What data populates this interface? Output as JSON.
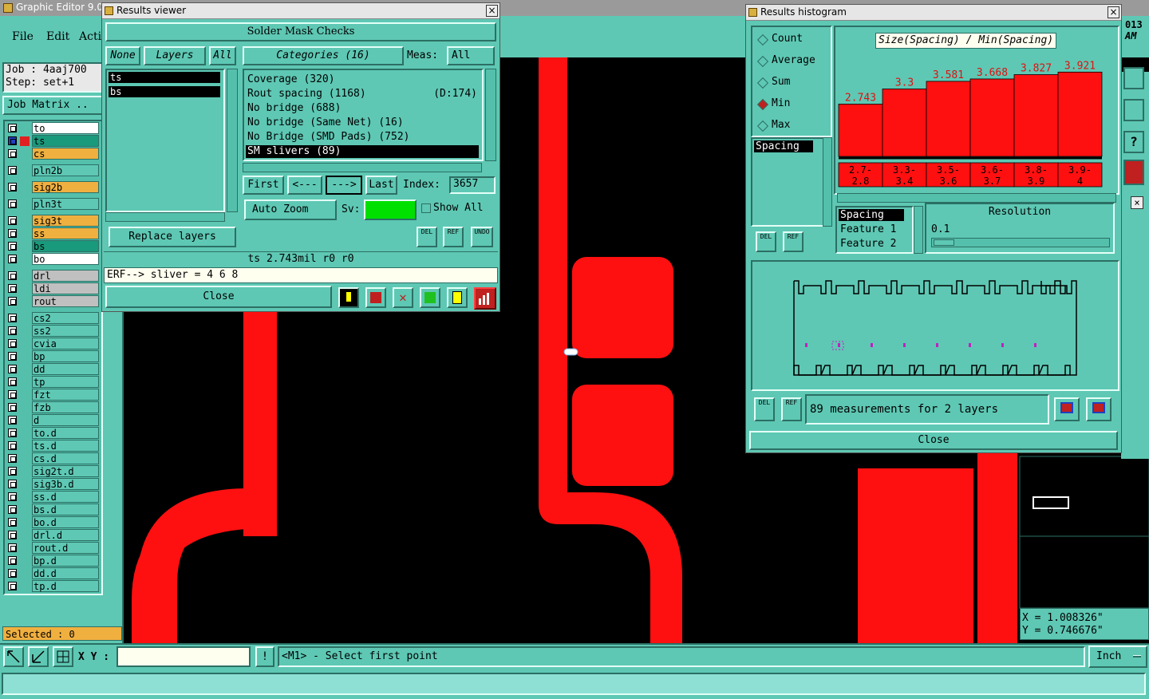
{
  "app": {
    "title": "Graphic Editor 9.02",
    "right_frag": "013",
    "right_frag2": "AM"
  },
  "menu": [
    "File",
    "Edit",
    "Acti"
  ],
  "job": {
    "job_label": "Job : 4aaj700",
    "step_label": "Step: set+1",
    "matrix_button": "Job Matrix .."
  },
  "layers": [
    {
      "name": "to",
      "color": "#ffffff"
    },
    {
      "name": "ts",
      "color": "#1a9a7c",
      "active": true
    },
    {
      "name": "cs",
      "color": "#f0b040"
    },
    {
      "name": "pln2b",
      "color": "#5ec8b4"
    },
    {
      "name": "sig2b",
      "color": "#f0b040"
    },
    {
      "name": "pln3t",
      "color": "#5ec8b4"
    },
    {
      "name": "sig3t",
      "color": "#f0b040"
    },
    {
      "name": "ss",
      "color": "#f0b040"
    },
    {
      "name": "bs",
      "color": "#1a9a7c"
    },
    {
      "name": "bo",
      "color": "#ffffff"
    },
    {
      "name": "drl",
      "color": "#c0c0c0"
    },
    {
      "name": "ldi",
      "color": "#c0c0c0"
    },
    {
      "name": "rout",
      "color": "#c0c0c0"
    },
    {
      "name": "cs2",
      "color": "#5ec8b4"
    },
    {
      "name": "ss2",
      "color": "#5ec8b4"
    },
    {
      "name": "cvia",
      "color": "#5ec8b4"
    },
    {
      "name": "bp",
      "color": "#5ec8b4"
    },
    {
      "name": "dd",
      "color": "#5ec8b4"
    },
    {
      "name": "tp",
      "color": "#5ec8b4"
    },
    {
      "name": "fzt",
      "color": "#5ec8b4"
    },
    {
      "name": "fzb",
      "color": "#5ec8b4"
    },
    {
      "name": "d",
      "color": "#5ec8b4"
    },
    {
      "name": "to.d",
      "color": "#5ec8b4"
    },
    {
      "name": "ts.d",
      "color": "#5ec8b4"
    },
    {
      "name": "cs.d",
      "color": "#5ec8b4"
    },
    {
      "name": "sig2t.d",
      "color": "#5ec8b4"
    },
    {
      "name": "sig3b.d",
      "color": "#5ec8b4"
    },
    {
      "name": "ss.d",
      "color": "#5ec8b4"
    },
    {
      "name": "bs.d",
      "color": "#5ec8b4"
    },
    {
      "name": "bo.d",
      "color": "#5ec8b4"
    },
    {
      "name": "drl.d",
      "color": "#5ec8b4"
    },
    {
      "name": "rout.d",
      "color": "#5ec8b4"
    },
    {
      "name": "bp.d",
      "color": "#5ec8b4"
    },
    {
      "name": "dd.d",
      "color": "#5ec8b4"
    },
    {
      "name": "tp.d",
      "color": "#5ec8b4"
    }
  ],
  "selected": "Selected : 0",
  "results_viewer": {
    "title": "Results viewer",
    "header": "Solder Mask Checks",
    "btn_none": "None",
    "btn_layers": "Layers",
    "btn_all": "All",
    "layer_list": [
      "ts",
      "bs"
    ],
    "categories_label": "Categories (16)",
    "meas_label": "Meas:",
    "meas_value": "All",
    "categories": [
      {
        "text": "Coverage (320)",
        "extra": ""
      },
      {
        "text": "Rout spacing (1168)",
        "extra": "(D:174)"
      },
      {
        "text": "No bridge (688)",
        "extra": ""
      },
      {
        "text": "No bridge (Same Net) (16)",
        "extra": ""
      },
      {
        "text": "No Bridge (SMD Pads) (752)",
        "extra": ""
      },
      {
        "text": "SM slivers (89)",
        "extra": "",
        "selected": true
      }
    ],
    "first": "First",
    "prev": "<---",
    "next": "--->",
    "last": "Last",
    "index_label": "Index:",
    "index_value": "3657",
    "auto_zoom": "Auto Zoom",
    "sv_label": "Sv:",
    "show_all": "Show All",
    "replace_layers": "Replace layers",
    "del": "DEL",
    "ref": "REF",
    "undo": "UNDO",
    "status": "ts 2.743mil  r0  r0",
    "erf": "ERF--> sliver = 4 6 8",
    "close": "Close"
  },
  "histogram": {
    "title": "Results histogram",
    "options": [
      {
        "label": "Count",
        "checked": false
      },
      {
        "label": "Average",
        "checked": false
      },
      {
        "label": "Sum",
        "checked": false
      },
      {
        "label": "Min",
        "checked": true
      },
      {
        "label": "Max",
        "checked": false
      }
    ],
    "measure_list": [
      "Spacing"
    ],
    "chart_title": "Size(Spacing) / Min(Spacing)",
    "field_list": [
      "Spacing",
      "Feature 1",
      "Feature 2"
    ],
    "resolution_label": "Resolution",
    "resolution_value": "0.1",
    "summary": "89 measurements for 2 layers",
    "close": "Close",
    "del": "DEL",
    "ref": "REF"
  },
  "chart_data": {
    "type": "bar",
    "title": "Size(Spacing) / Min(Spacing)",
    "categories": [
      "2.7-2.8",
      "3.3-3.4",
      "3.5-3.6",
      "3.6-3.7",
      "3.8-3.9",
      "3.9-4"
    ],
    "values": [
      2.743,
      3.3,
      3.581,
      3.668,
      3.827,
      3.921
    ],
    "labels": [
      "2.743",
      "3.3",
      "3.581",
      "3.668",
      "3.827",
      "3.921"
    ],
    "cat_top": [
      "2.7-",
      "3.3-",
      "3.5-",
      "3.6-",
      "3.8-",
      "3.9-"
    ],
    "cat_bot": [
      "2.8",
      "3.4",
      "3.6",
      "3.7",
      "3.9",
      "4"
    ],
    "ylim": [
      0,
      4.4
    ],
    "bar_color": "#ff1010"
  },
  "coords": {
    "x": "X = 1.008326\"",
    "y": "Y = 0.746676\""
  },
  "bottom": {
    "xy_label": "X Y :",
    "xy_value": "",
    "prompt": "<M1> - Select first point",
    "units": "Inch"
  },
  "colors": {
    "trace": "#ff1010",
    "canvas": "#000000",
    "panel": "#5ec8b4"
  }
}
